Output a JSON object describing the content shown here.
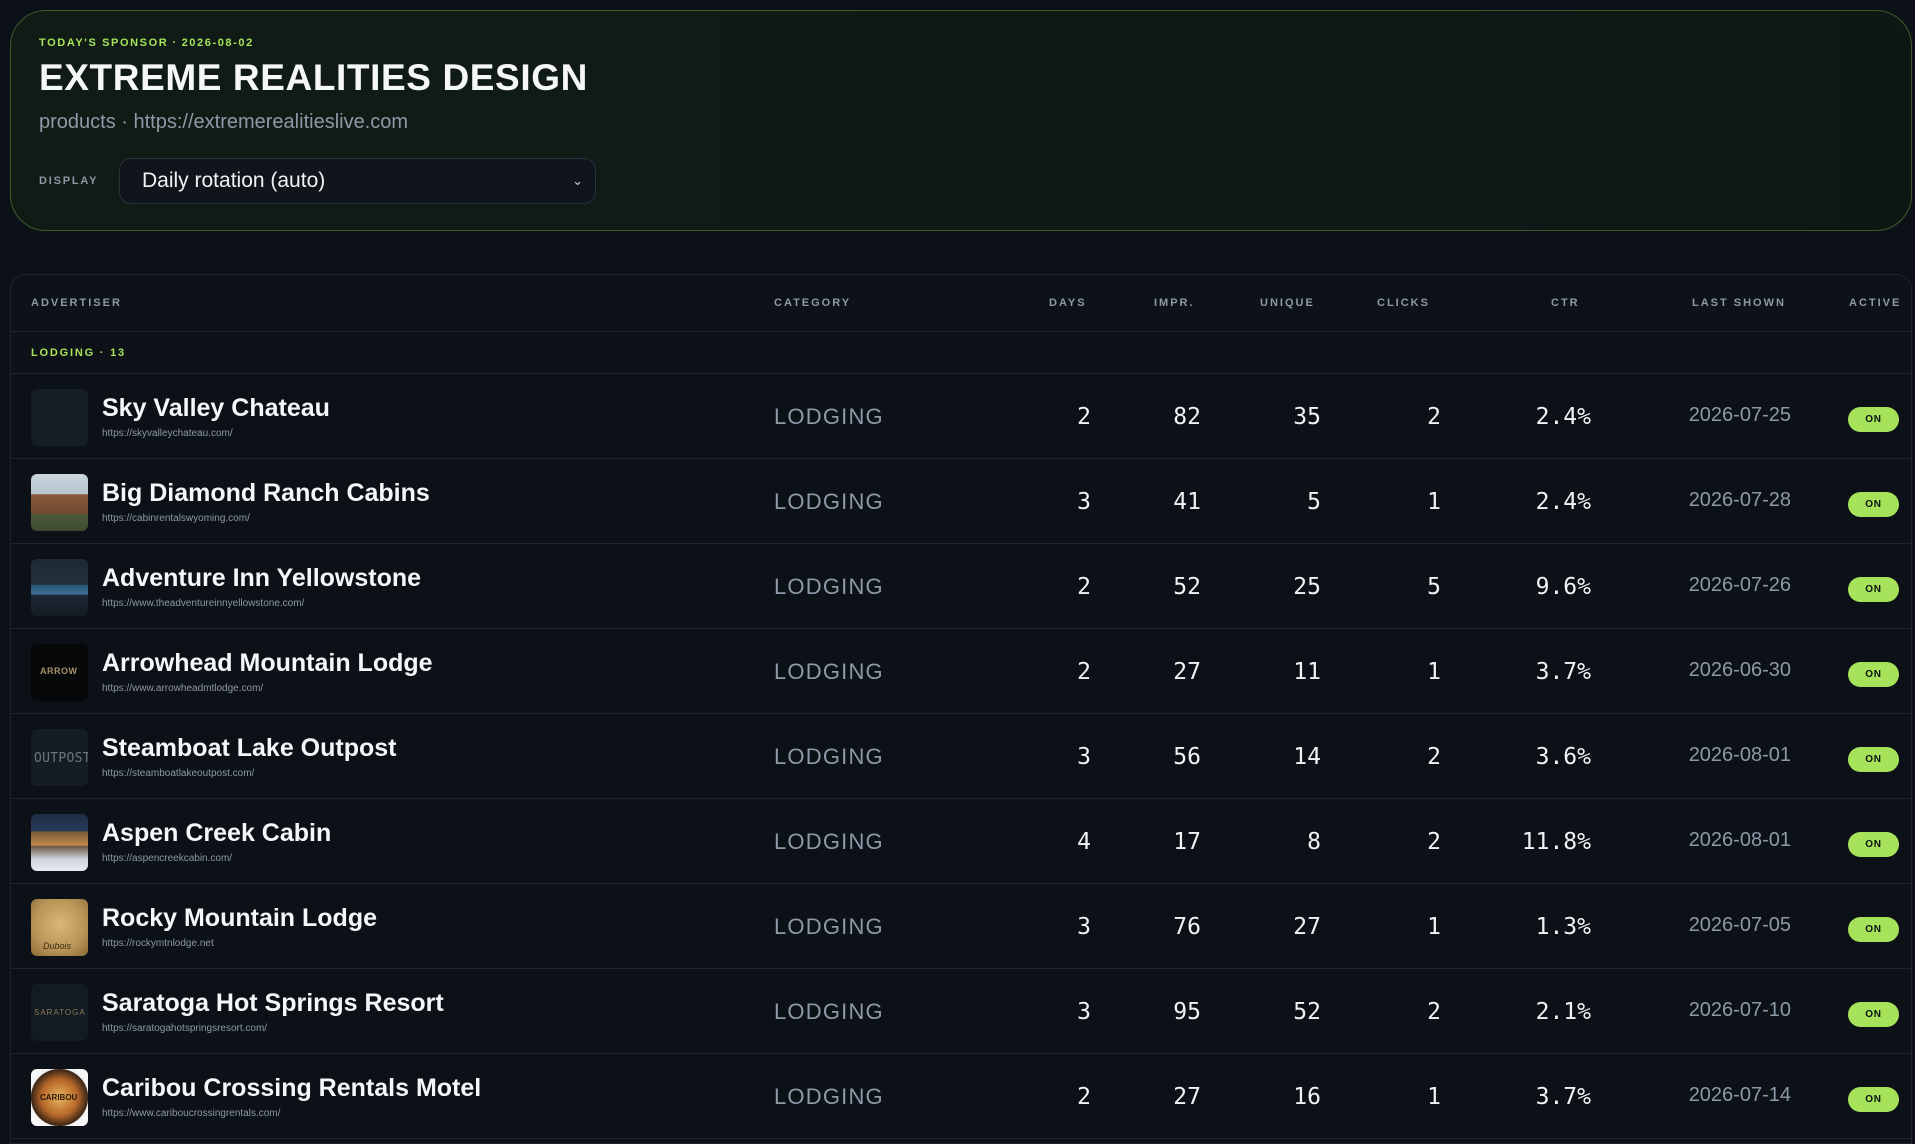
{
  "sponsor": {
    "eyebrow_label": "TODAY'S SPONSOR",
    "date": "2026-08-02",
    "name": "EXTREME REALITIES DESIGN",
    "category": "products",
    "url": "https://extremerealitieslive.com",
    "display_label": "DISPLAY",
    "display_value": "Daily rotation (auto)"
  },
  "table": {
    "headers": {
      "advertiser": "ADVERTISER",
      "category": "CATEGORY",
      "days": "DAYS",
      "impr": "IMPR.",
      "unique": "UNIQUE",
      "clicks": "CLICKS",
      "ctr": "CTR",
      "last_shown": "LAST SHOWN",
      "active": "ACTIVE"
    },
    "group": {
      "name": "LODGING",
      "count": "13"
    },
    "rows": [
      {
        "name": "Sky Valley Chateau",
        "url": "https://skyvalleychateau.com/",
        "category": "LODGING",
        "days": "2",
        "impr": "82",
        "unique": "35",
        "clicks": "2",
        "ctr": "2.4%",
        "last_shown": "2026-07-25",
        "active": "ON",
        "thumb": "blank"
      },
      {
        "name": "Big Diamond Ranch Cabins",
        "url": "https://cabinrentalswyoming.com/",
        "category": "LODGING",
        "days": "3",
        "impr": "41",
        "unique": "5",
        "clicks": "1",
        "ctr": "2.4%",
        "last_shown": "2026-07-28",
        "active": "ON",
        "thumb": "photo-cabin"
      },
      {
        "name": "Adventure Inn Yellowstone",
        "url": "https://www.theadventureinnyellowstone.com/",
        "category": "LODGING",
        "days": "2",
        "impr": "52",
        "unique": "25",
        "clicks": "5",
        "ctr": "9.6%",
        "last_shown": "2026-07-26",
        "active": "ON",
        "thumb": "photo-pool"
      },
      {
        "name": "Arrowhead Mountain Lodge",
        "url": "https://www.arrowheadmtlodge.com/",
        "category": "LODGING",
        "days": "2",
        "impr": "27",
        "unique": "11",
        "clicks": "1",
        "ctr": "3.7%",
        "last_shown": "2026-06-30",
        "active": "ON",
        "thumb": "logo-dark"
      },
      {
        "name": "Steamboat Lake Outpost",
        "url": "https://steamboatlakeoutpost.com/",
        "category": "LODGING",
        "days": "3",
        "impr": "56",
        "unique": "14",
        "clicks": "2",
        "ctr": "3.6%",
        "last_shown": "2026-08-01",
        "active": "ON",
        "thumb": "logo-outpost"
      },
      {
        "name": "Aspen Creek Cabin",
        "url": "https://aspencreekcabin.com/",
        "category": "LODGING",
        "days": "4",
        "impr": "17",
        "unique": "8",
        "clicks": "2",
        "ctr": "11.8%",
        "last_shown": "2026-08-01",
        "active": "ON",
        "thumb": "photo-night"
      },
      {
        "name": "Rocky Mountain Lodge",
        "url": "https://rockymtnlodge.net",
        "category": "LODGING",
        "days": "3",
        "impr": "76",
        "unique": "27",
        "clicks": "1",
        "ctr": "1.3%",
        "last_shown": "2026-07-05",
        "active": "ON",
        "thumb": "logo-trees"
      },
      {
        "name": "Saratoga Hot Springs Resort",
        "url": "https://saratogahotspringsresort.com/",
        "category": "LODGING",
        "days": "3",
        "impr": "95",
        "unique": "52",
        "clicks": "2",
        "ctr": "2.1%",
        "last_shown": "2026-07-10",
        "active": "ON",
        "thumb": "logo-saratoga"
      },
      {
        "name": "Caribou Crossing Rentals Motel",
        "url": "https://www.cariboucrossingrentals.com/",
        "category": "LODGING",
        "days": "2",
        "impr": "27",
        "unique": "16",
        "clicks": "1",
        "ctr": "3.7%",
        "last_shown": "2026-07-14",
        "active": "ON",
        "thumb": "logo-caribou"
      }
    ]
  },
  "colors": {
    "accent": "#a6e35a",
    "background": "#0b1117",
    "muted_text": "#8d99a6"
  }
}
